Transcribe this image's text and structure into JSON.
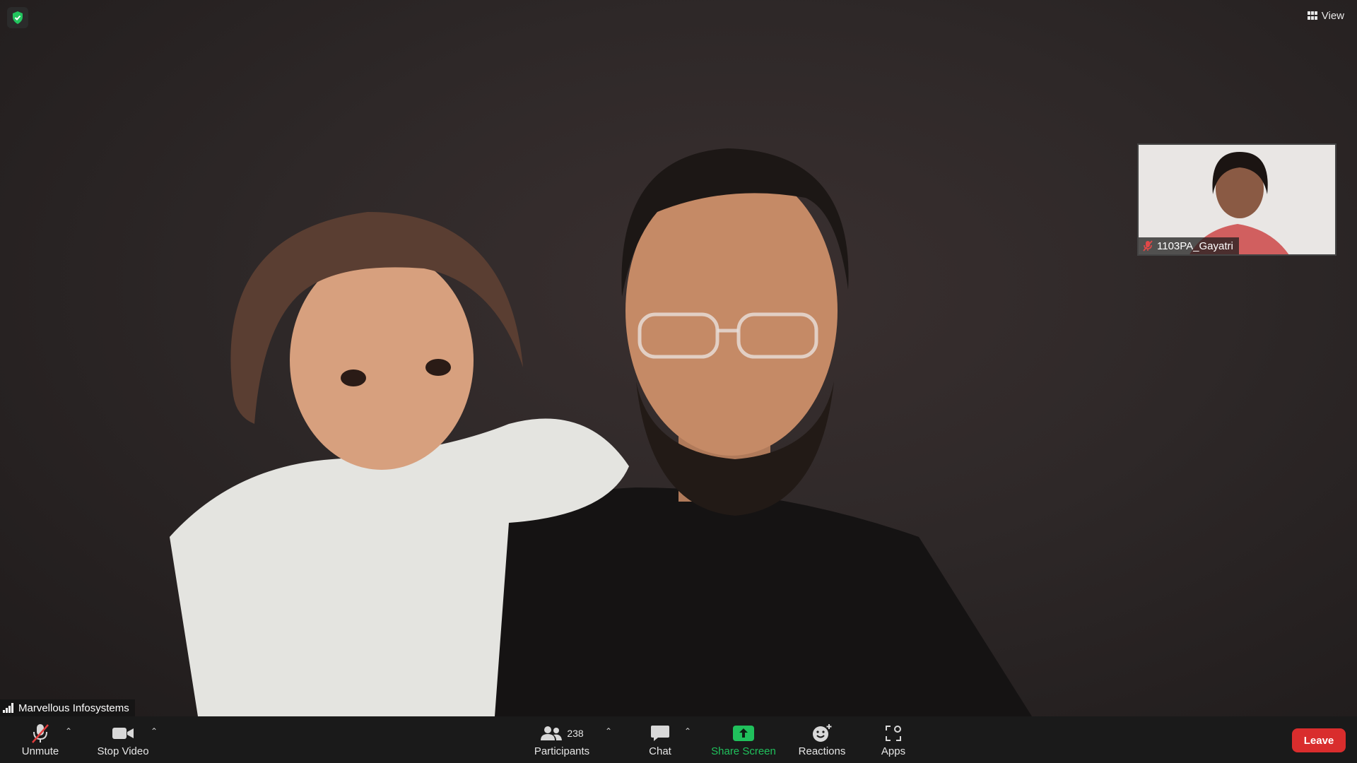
{
  "top": {
    "view_label": "View"
  },
  "thumbnail": {
    "participant_name": "1103PA_Gayatri"
  },
  "active_speaker": {
    "name": "Marvellous Infosystems"
  },
  "toolbar": {
    "unmute_label": "Unmute",
    "stop_video_label": "Stop Video",
    "participants_label": "Participants",
    "participants_count": "238",
    "chat_label": "Chat",
    "share_screen_label": "Share Screen",
    "reactions_label": "Reactions",
    "apps_label": "Apps",
    "leave_label": "Leave"
  },
  "colors": {
    "share_green": "#20c05c",
    "leave_red": "#d92d2d",
    "shield_green": "#22c55e"
  }
}
